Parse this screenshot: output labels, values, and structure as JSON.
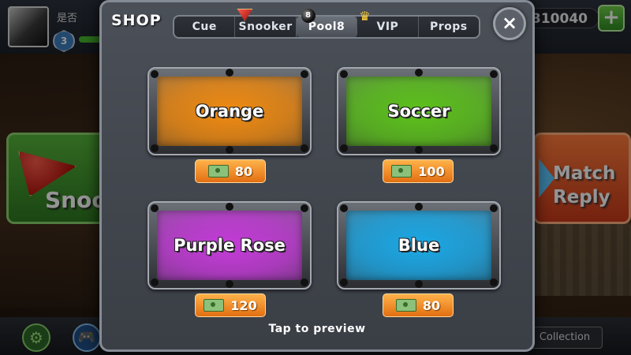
{
  "background": {
    "player": {
      "name": "是否",
      "level": "3"
    },
    "coins": "310040",
    "modes": {
      "left_label": "Snoo",
      "right_label_line1": "Match",
      "right_label_line2": "Reply"
    },
    "bottom": {
      "collection_label": "Collection"
    }
  },
  "shop": {
    "title": "SHOP",
    "close_label": "×",
    "tabs": [
      {
        "label": "Cue",
        "icon": ""
      },
      {
        "label": "Snooker",
        "icon": "snooker-triangle-icon"
      },
      {
        "label": "Pool8",
        "icon": "eight-ball-icon"
      },
      {
        "label": "VIP",
        "icon": "vip-crown-icon"
      },
      {
        "label": "Props",
        "icon": ""
      }
    ],
    "active_tab": "Pool8",
    "tables": [
      {
        "name": "Orange",
        "price": "80",
        "felt_color": "#f08a10"
      },
      {
        "name": "Soccer",
        "price": "100",
        "felt_color": "#5cc21a"
      },
      {
        "name": "Purple Rose",
        "price": "120",
        "felt_color": "#c43ad8"
      },
      {
        "name": "Blue",
        "price": "80",
        "felt_color": "#1aa8e6"
      }
    ],
    "hint": "Tap to preview"
  },
  "colors": {
    "price_button": "#f0881c",
    "modal_bg": "#43484f"
  }
}
